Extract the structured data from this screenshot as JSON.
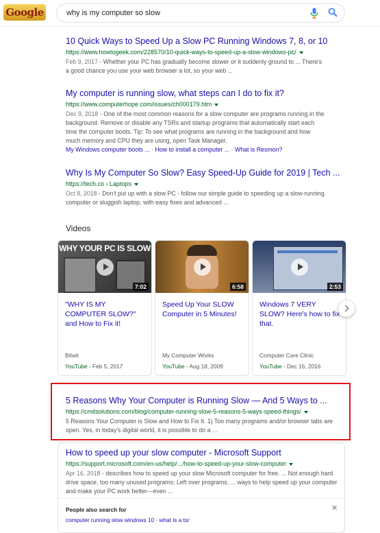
{
  "header": {
    "logo_text": "Google",
    "search_value": "why is my computer so slow"
  },
  "results": [
    {
      "title": "10 Quick Ways to Speed Up a Slow PC Running Windows 7, 8, or 10",
      "url": "https://www.howtogeek.com/228570/10-quick-ways-to-speed-up-a-slow-windows-pc/",
      "date": "Feb 9, 2017",
      "snippet": " - Whether your PC has gradually become slower or it suddenly ground to ... There's a good chance you use your web browser a lot, so your web ..."
    },
    {
      "title": "My computer is running slow, what steps can I do to fix it?",
      "url": "https://www.computerhope.com/issues/ch000179.htm",
      "date": "Dec 9, 2018",
      "snippet": " - One of the most common reasons for a slow computer are programs running in the background. Remove or disable any TSRs and startup programs that automatically start each time the computer boots. Tip: To see what programs are running in the background and how much memory and CPU they are using, open Task Manager.",
      "sitelinks": [
        "My Windows computer boots ...",
        "How to install a computer ...",
        "What is Resmon?"
      ]
    },
    {
      "title": "Why Is My Computer So Slow? Easy Speed-Up Guide for 2019 | Tech ...",
      "url": "https://tech.co › Laptops",
      "date": "Oct 8, 2018",
      "snippet": " - Don't put up with a slow PC - follow our simple guide to speeding up a slow-running computer or sluggish laptop, with easy fixes and advanced ..."
    }
  ],
  "videos": {
    "heading": "Videos",
    "items": [
      {
        "thumb_text": "WHY YOUR PC IS SLOW",
        "duration": "7:02",
        "title": "\"WHY IS MY COMPUTER SLOW?\" and How to Fix it!",
        "channel": "Bitwit",
        "source": "YouTube",
        "date": " - Feb 5, 2017"
      },
      {
        "thumb_text": "",
        "duration": "6:58",
        "title": "Speed Up Your SLOW Computer in 5 Minutes!",
        "channel": "My Computer Works",
        "source": "YouTube",
        "date": " - Aug 18, 2009"
      },
      {
        "thumb_text": "",
        "duration": "2:53",
        "title": "Windows 7 VERY SLOW? Here's how to fix that.",
        "channel": "Computer Care Clinic",
        "source": "YouTube",
        "date": " - Dec 16, 2016"
      }
    ]
  },
  "highlighted_result": {
    "title": "5 Reasons Why Your Computer is Running Slow — And 5 Ways to ...",
    "url": "https://cmitsolutions.com/blog/computer-running-slow-5-reasons-5-ways-speed-things/",
    "snippet": "5 Reasons Your Computer is Slow and How to Fix It. 1) Too many programs and/or browser tabs are open. Yes, in today's digital world, it is possible to do a ..."
  },
  "microsoft_result": {
    "title": "How to speed up your slow computer - Microsoft Support",
    "url": "https://support.microsoft.com/en-us/help/.../how-to-speed-up-your-slow-computer",
    "date": "Apr 16, 2018",
    "snippet": " - describes how to speed up your slow Microsoft computer for free. ... Not enough hard drive space, too many unused programs; Left over programs, ... ways to help speed up your computer and make your PC work better—even ...",
    "people_also_search": "People also search for",
    "close": "✕",
    "related_partial": "computer running slow windows 10 · what is a tsr"
  },
  "colors": {
    "link": "#1a0dab",
    "url": "#006621",
    "snippet": "#545454",
    "highlight_border": "#e2141a"
  }
}
